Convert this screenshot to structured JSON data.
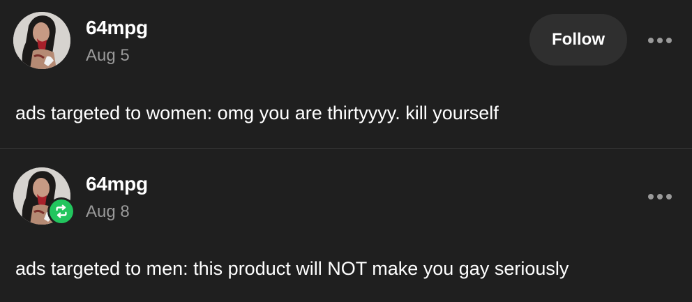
{
  "posts": [
    {
      "username": "64mpg",
      "date": "Aug 5",
      "follow_label": "Follow",
      "avatar_icon": "user-avatar",
      "text": "ads targeted to women: omg you are thirtyyyy. kill yourself"
    },
    {
      "username": "64mpg",
      "date": "Aug 8",
      "avatar_icon": "user-avatar",
      "badge_icon": "reblog-icon",
      "text": "ads targeted to men: this product will NOT make you gay seriously"
    }
  ],
  "colors": {
    "background": "#1f1f1f",
    "follow_button": "#2f2f2f",
    "muted_text": "#9a9a9a",
    "reblog_green": "#22c55e"
  }
}
